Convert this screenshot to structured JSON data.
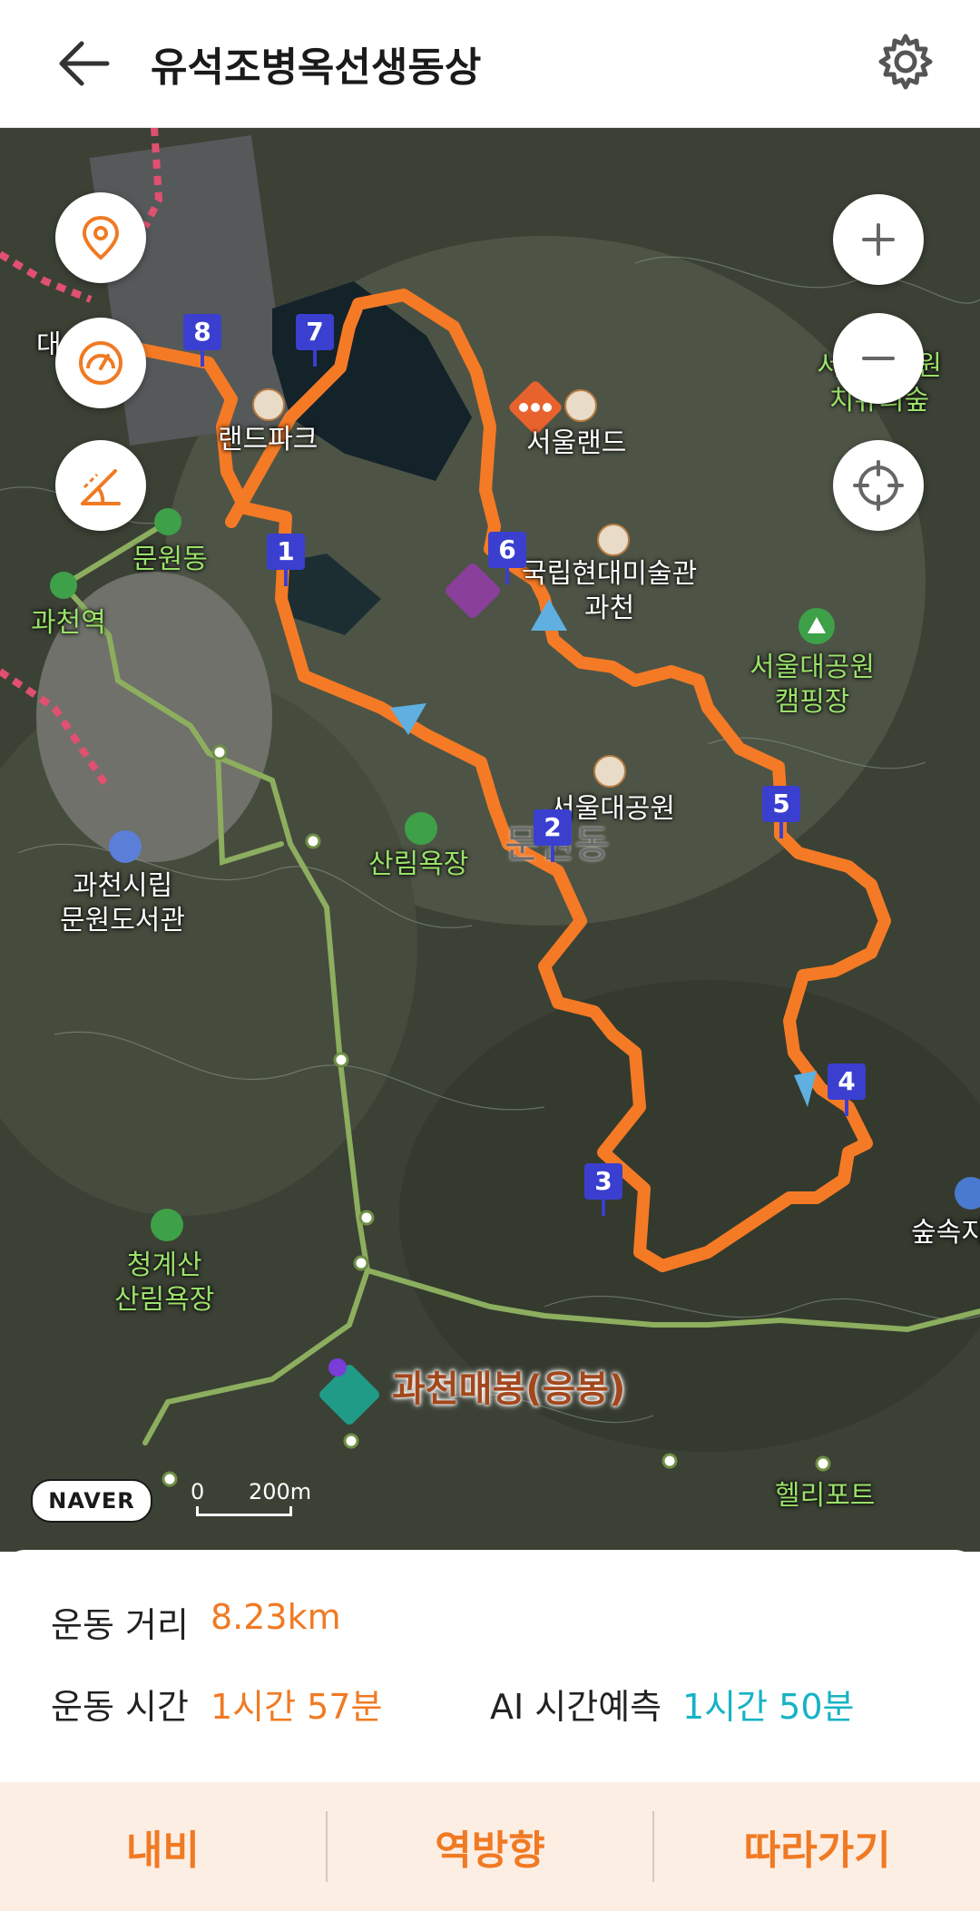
{
  "header": {
    "title": "유석조병옥선생동상",
    "back_icon": "back-arrow-icon",
    "settings_icon": "gear-icon"
  },
  "map": {
    "labels": {
      "park_top_left": "대",
      "theme_park": "랜드파크",
      "seoulland": "서울랜드",
      "museum": "국립현대미술관\n과천",
      "camping": "서울대공원\n캠핑장",
      "grand_park": "서울대공원",
      "munwondong_big": "문원동",
      "forest_bath": "산림욕장",
      "munwondong_small": "문원동",
      "gwacheon_station": "과천역",
      "library": "과천시립\n문원도서관",
      "cheonggyesan": "청계산\n산림욕장",
      "peak": "과천매봉(응봉)",
      "heliport": "헬리포트",
      "forest_right": "숲속지",
      "forest_top_right": "서울대공원\n치유의숲"
    },
    "markers": [
      "8",
      "7",
      "1",
      "6",
      "2",
      "5",
      "4",
      "3"
    ],
    "naver_logo": "NAVER",
    "scale": {
      "start": "0",
      "end": "200m"
    },
    "buttons": {
      "location": "location-pin-icon",
      "speed": "speedometer-icon",
      "slope": "slope-icon",
      "zoom_in": "plus-icon",
      "zoom_out": "minus-icon",
      "recenter": "crosshair-icon"
    },
    "route_color": "#f57a25"
  },
  "stats": {
    "distance_label": "운동 거리",
    "distance_value": "8.23km",
    "time_label": "운동 시간",
    "time_value": "1시간 57분",
    "ai_label": "AI 시간예측",
    "ai_value": "1시간 50분"
  },
  "actions": {
    "navi": "내비",
    "reverse": "역방향",
    "follow": "따라가기"
  },
  "colors": {
    "accent": "#f07a23",
    "teal": "#17b3c4",
    "marker": "#3a3fcf"
  }
}
